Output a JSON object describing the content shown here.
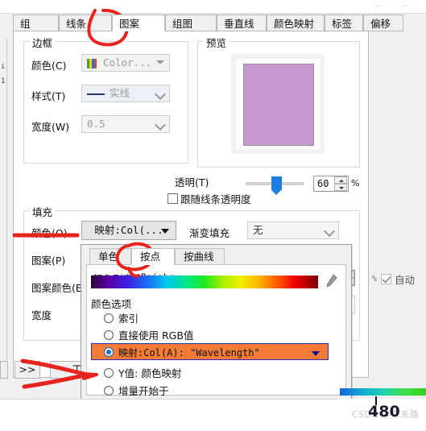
{
  "window": {
    "title_bar_controls": "⌐ ⌐"
  },
  "tabs": [
    {
      "label": "组",
      "selected": false
    },
    {
      "label": "线条",
      "selected": false
    },
    {
      "label": "图案",
      "selected": true
    },
    {
      "label": "组图",
      "selected": false
    },
    {
      "label": "垂直线",
      "selected": false
    },
    {
      "label": "颜色映射",
      "selected": false
    },
    {
      "label": "标签",
      "selected": false
    },
    {
      "label": "偏移",
      "selected": false
    }
  ],
  "border_group": {
    "title": "边框",
    "color_label": "颜色(C)",
    "color_value": "Color...",
    "style_label": "样式(T)",
    "style_value": "实线",
    "width_label": "宽度(W)",
    "width_value": "0.5"
  },
  "preview_group": {
    "title": "预览",
    "fill_color": "#c797d1"
  },
  "transparency": {
    "label": "透明(T)",
    "value": "60",
    "unit": "%",
    "follow_line_label": "跟随线条透明度",
    "follow_line_checked": false
  },
  "fill_group": {
    "title": "填充",
    "color_label": "颜色(O)",
    "color_value": "映射:Col(...",
    "gradient_label": "渐变填充",
    "gradient_value": "无",
    "pattern_label": "图案(P)",
    "pattern_color_label": "图案颜色(E)",
    "pattern_width_label": "宽度",
    "auto_label": "自动",
    "auto_checked": true
  },
  "popup": {
    "tabs": [
      {
        "label": "单色",
        "selected": false
      },
      {
        "label": "按点",
        "selected": true
      },
      {
        "label": "按曲线",
        "selected": false
      }
    ],
    "color_list_label": "颜色列表:",
    "color_list_value": "Rainbow",
    "palette_name": "rainbow-gradient",
    "edit_icon": "pencil-icon",
    "options_title": "颜色选项",
    "options": [
      {
        "label": "索引",
        "selected": false,
        "has_dropdown": false
      },
      {
        "label": "直接使用 RGB值",
        "selected": false,
        "has_dropdown": false
      },
      {
        "label": "映射:Col(A): \"Wavelength\"",
        "selected": true,
        "has_dropdown": true
      },
      {
        "label": "Y值: 颜色映射",
        "selected": false,
        "has_dropdown": false
      },
      {
        "label": "增量开始于",
        "selected": false,
        "has_dropdown": false
      }
    ],
    "highlight_color": "#f57c37"
  },
  "bottom_bar": {
    "expand_button": ">>",
    "worksheet_button": "工作..."
  },
  "overlay": {
    "colorbar_tick_value": "480",
    "watermark": "CSDN @东来路",
    "left_edge_text_1": "i",
    "left_edge_text_2": "1",
    "annotation_color": "#e8231e",
    "annotations": [
      "circle-on-tab-图案",
      "circle-on-tab-按点",
      "arrow-to-颜色O",
      "arrow-to-映射Col-A-option"
    ]
  }
}
